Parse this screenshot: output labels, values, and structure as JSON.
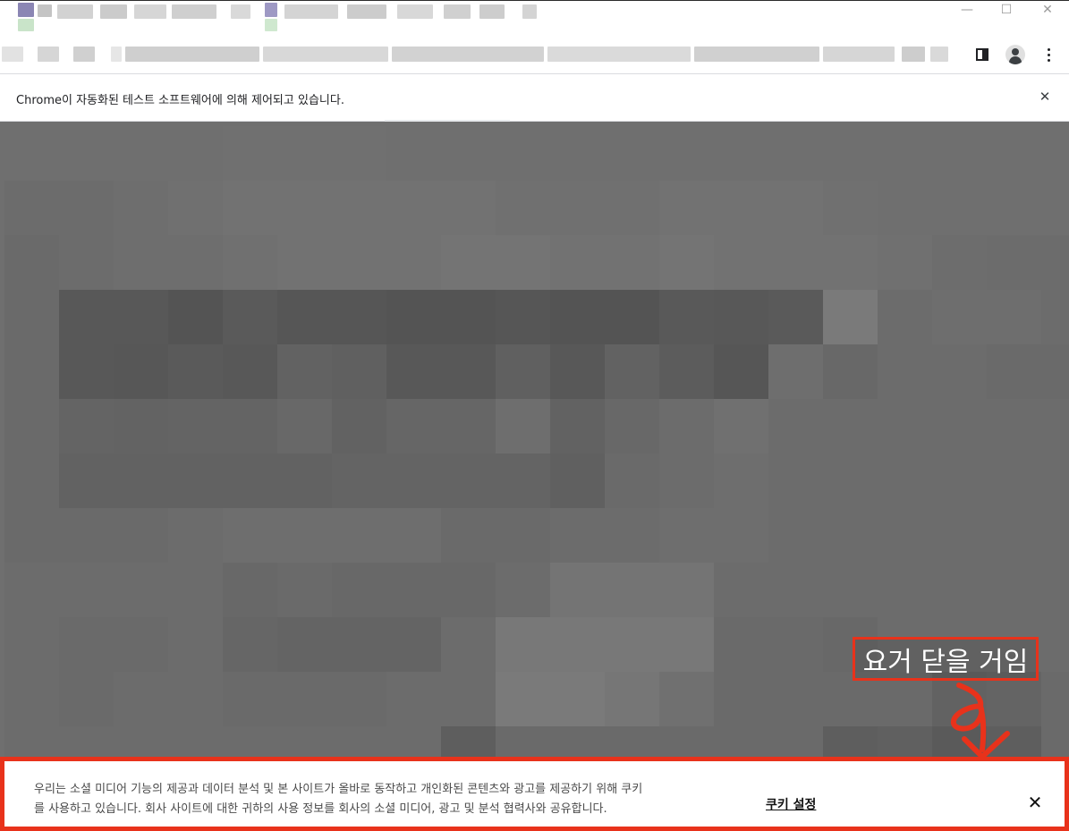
{
  "window": {
    "minimize_glyph": "—",
    "maximize_glyph": "☐",
    "close_glyph": "✕"
  },
  "toolbar": {
    "panel_icon": "side-panel-icon",
    "profile_icon": "profile-avatar-icon",
    "menu_icon": "kebab-menu-icon"
  },
  "infobar": {
    "message": "Chrome이 자동화된 테스트 소프트웨어에 의해 제어되고 있습니다.",
    "close_glyph": "✕"
  },
  "annotation": {
    "label": "요거 닫을 거임",
    "color": "#e8321b"
  },
  "cookie_banner": {
    "text": "우리는 소셜 미디어 기능의 제공과 데이터 분석 및 본 사이트가 올바로 동작하고 개인화된 콘텐츠와 광고를 제공하기 위해 쿠키를 사용하고 있습니다. 회사 사이트에 대한 귀하의 사용 정보를 회사의 소셜 미디어, 광고 및 분석 협력사와 공유합니다.",
    "settings_label": "쿠키 설정",
    "close_glyph": "✕"
  },
  "colors": {
    "highlight": "#e8321b",
    "page_background": "#6f6f6f"
  }
}
